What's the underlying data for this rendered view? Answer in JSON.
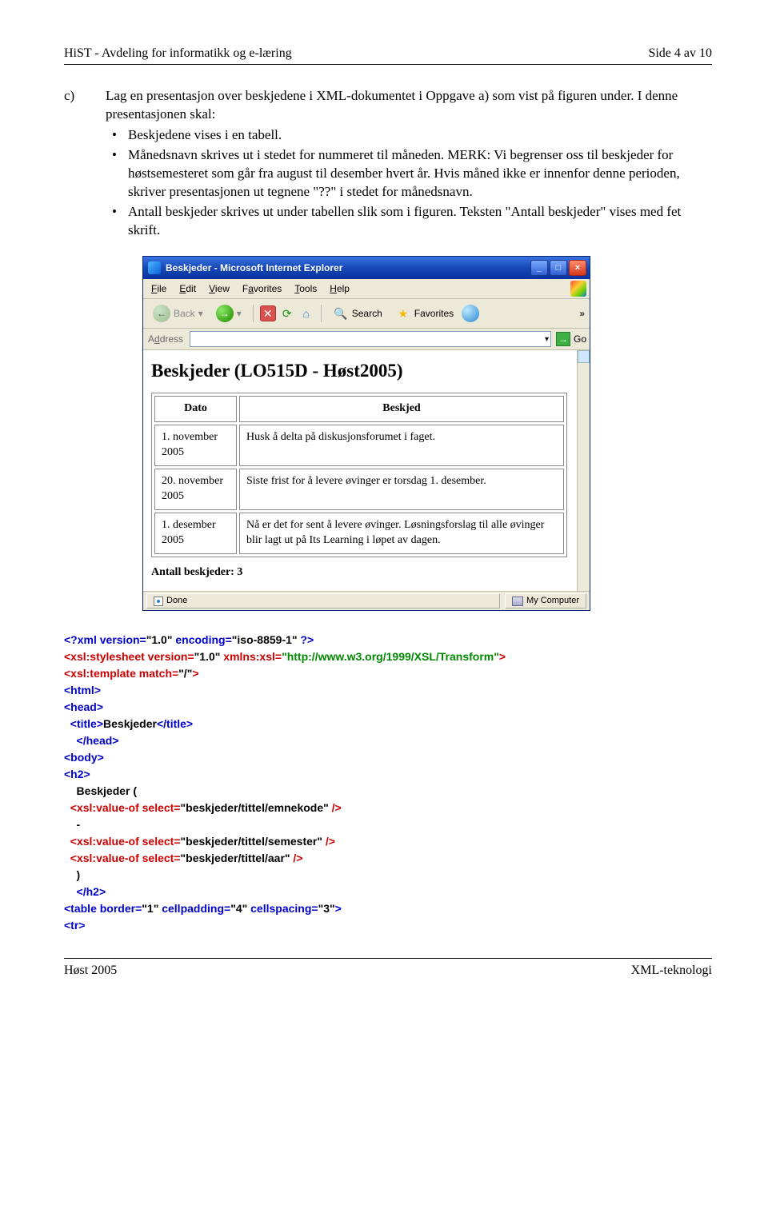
{
  "header": {
    "left": "HiST - Avdeling for informatikk og e-læring",
    "right": "Side 4 av 10"
  },
  "task": {
    "letter": "c)",
    "intro": "Lag en presentasjon over beskjedene i XML-dokumentet i Oppgave a) som vist på figuren under. I denne presentasjonen skal:",
    "b1": "Beskjedene vises i en tabell.",
    "b2": "Månedsnavn skrives ut i stedet for nummeret til måneden. MERK: Vi begrenser oss til beskjeder for høstsemesteret som går fra august til desember hvert år. Hvis måned ikke er innenfor denne perioden, skriver presentasjonen ut tegnene \"??\" i stedet for månedsnavn.",
    "b3": "Antall beskjeder skrives ut under tabellen slik som i figuren. Teksten \"Antall beskjeder\" vises med fet skrift."
  },
  "ie": {
    "title": "Beskjeder - Microsoft Internet Explorer",
    "menu": {
      "file": "File",
      "edit": "Edit",
      "view": "View",
      "fav": "Favorites",
      "tools": "Tools",
      "help": "Help"
    },
    "toolbar": {
      "back": "Back",
      "search": "Search",
      "favorites": "Favorites"
    },
    "address_label": "Address",
    "go": "Go",
    "status_done": "Done",
    "status_zone": "My Computer",
    "page_heading": "Beskjeder (LO515D - Høst2005)",
    "th_date": "Dato",
    "th_msg": "Beskjed",
    "rows": [
      {
        "date": "1. november 2005",
        "msg": "Husk å delta på diskusjonsforumet i faget."
      },
      {
        "date": "20. november 2005",
        "msg": "Siste frist for å levere øvinger er torsdag 1. desember."
      },
      {
        "date": "1. desember 2005",
        "msg": "Nå er det for sent å levere øvinger. Løsningsforslag til alle øvinger blir lagt ut på Its Learning i løpet av dagen."
      }
    ],
    "count_label": "Antall beskjeder:",
    "count": "3"
  },
  "code": {
    "l1a": "<?xml version=",
    "l1b": "\"1.0\"",
    "l1c": " encoding=",
    "l1d": "\"iso-8859-1\"",
    "l1e": " ?>",
    "l2a": "<xsl:stylesheet version=",
    "l2b": "\"1.0\"",
    "l2c": " xmlns:xsl=",
    "l2d": "\"http://www.w3.org/1999/XSL/Transform\"",
    "l2e": ">",
    "l3a": "<xsl:template match=",
    "l3b": "\"/\"",
    "l3c": ">",
    "l4": "<html>",
    "l5": "<head>",
    "l6a": "  <title>",
    "l6b": "Beskjeder",
    "l6c": "</title>",
    "l7": "    </head>",
    "l8": "<body>",
    "l9": "<h2>",
    "l10": "    Beskjeder (",
    "l11a": "  <xsl:value-of select=",
    "l11b": "\"beskjeder/tittel/emnekode\"",
    "l11c": " />",
    "l12": "    -",
    "l13a": "  <xsl:value-of select=",
    "l13b": "\"beskjeder/tittel/semester\"",
    "l13c": " />",
    "l14a": "  <xsl:value-of select=",
    "l14b": "\"beskjeder/tittel/aar\"",
    "l14c": " />",
    "l15": "    )",
    "l16": "    </h2>",
    "l17a": "<table border=",
    "l17b": "\"1\"",
    "l17c": " cellpadding=",
    "l17d": "\"4\"",
    "l17e": " cellspacing=",
    "l17f": "\"3\"",
    "l17g": ">",
    "l18": "<tr>"
  },
  "footer": {
    "left": "Høst 2005",
    "right": "XML-teknologi"
  }
}
